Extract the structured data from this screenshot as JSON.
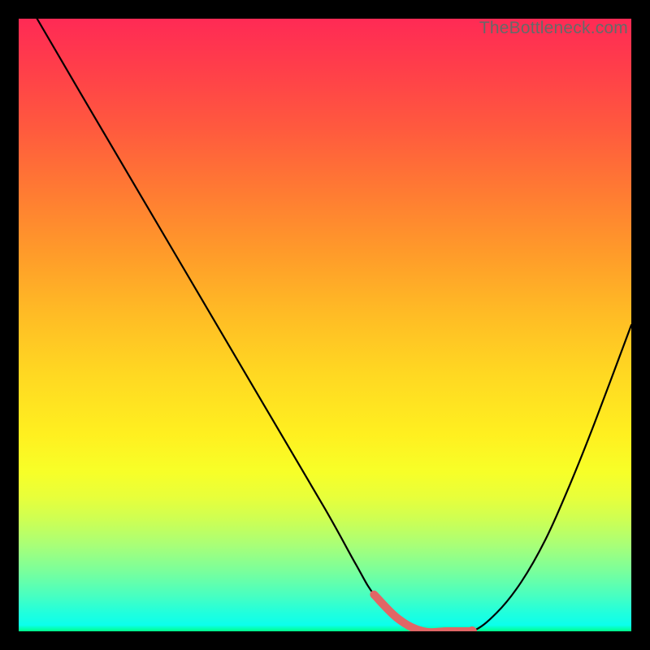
{
  "watermark": "TheBottleneck.com",
  "chart_data": {
    "type": "line",
    "title": "",
    "xlabel": "",
    "ylabel": "",
    "xlim": [
      0,
      100
    ],
    "ylim": [
      0,
      100
    ],
    "grid": false,
    "legend": false,
    "series": [
      {
        "name": "bottleneck-curve",
        "x": [
          3,
          10,
          20,
          30,
          40,
          50,
          55,
          58,
          62,
          66,
          70,
          74,
          78,
          82,
          86,
          90,
          94,
          100
        ],
        "values": [
          100,
          88,
          71,
          54,
          37,
          20,
          11,
          6,
          2,
          0,
          0,
          0,
          3,
          8,
          15,
          24,
          34,
          50
        ]
      }
    ],
    "marker_segment": {
      "name": "optimal-range",
      "x": [
        58,
        62,
        66,
        70,
        74
      ],
      "values": [
        6,
        2,
        0,
        0,
        0
      ],
      "color": "#e06666"
    },
    "background_gradient": {
      "stops": [
        {
          "pos": 0,
          "color": "#ff2a55"
        },
        {
          "pos": 50,
          "color": "#ffd020"
        },
        {
          "pos": 80,
          "color": "#e8ff3a"
        },
        {
          "pos": 100,
          "color": "#00ff88"
        }
      ]
    }
  }
}
